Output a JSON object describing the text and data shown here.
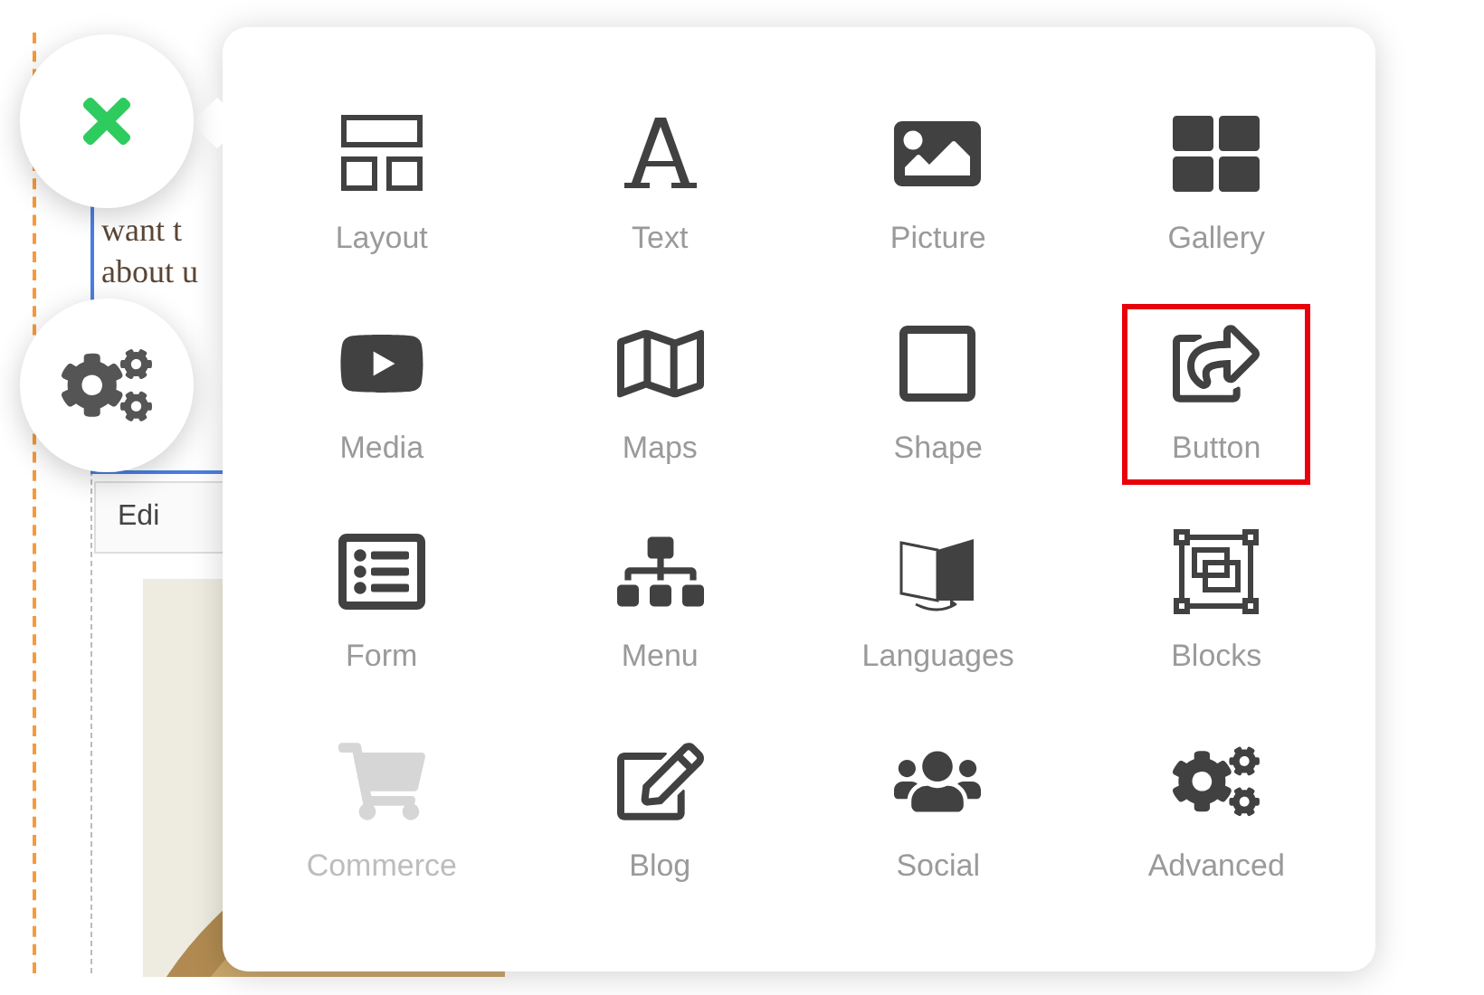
{
  "page": {
    "text_lines": [
      "want t",
      "about u"
    ],
    "edit_label": "Edi"
  },
  "controls": [
    {
      "kind": "close"
    },
    {
      "kind": "settings"
    }
  ],
  "panel": {
    "items": [
      {
        "label": "Layout",
        "disabled": false,
        "highlighted": false
      },
      {
        "label": "Text",
        "disabled": false,
        "highlighted": false
      },
      {
        "label": "Picture",
        "disabled": false,
        "highlighted": false
      },
      {
        "label": "Gallery",
        "disabled": false,
        "highlighted": false
      },
      {
        "label": "Media",
        "disabled": false,
        "highlighted": false
      },
      {
        "label": "Maps",
        "disabled": false,
        "highlighted": false
      },
      {
        "label": "Shape",
        "disabled": false,
        "highlighted": false
      },
      {
        "label": "Button",
        "disabled": false,
        "highlighted": true
      },
      {
        "label": "Form",
        "disabled": false,
        "highlighted": false
      },
      {
        "label": "Menu",
        "disabled": false,
        "highlighted": false
      },
      {
        "label": "Languages",
        "disabled": false,
        "highlighted": false
      },
      {
        "label": "Blocks",
        "disabled": false,
        "highlighted": false
      },
      {
        "label": "Commerce",
        "disabled": true,
        "highlighted": false
      },
      {
        "label": "Blog",
        "disabled": false,
        "highlighted": false
      },
      {
        "label": "Social",
        "disabled": false,
        "highlighted": false
      },
      {
        "label": "Advanced",
        "disabled": false,
        "highlighted": false
      }
    ]
  }
}
